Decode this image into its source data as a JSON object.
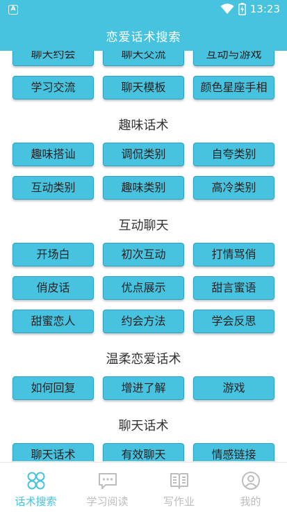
{
  "status_bar": {
    "app_icon_letter": "A",
    "time": "13:23"
  },
  "header": {
    "title": "恋爱话术搜索"
  },
  "sections": [
    {
      "title": "",
      "buttons": [
        "聊天约会",
        "聊天交流",
        "互动与游戏",
        "学习交流",
        "聊天模板",
        "颜色星座手相"
      ]
    },
    {
      "title": "趣味话术",
      "buttons": [
        "趣味搭讪",
        "调侃类别",
        "自夸类别",
        "互动类别",
        "趣味类别",
        "高冷类别"
      ]
    },
    {
      "title": "互动聊天",
      "buttons": [
        "开场白",
        "初次互动",
        "打情骂俏",
        "俏皮话",
        "优点展示",
        "甜言蜜语",
        "甜蜜恋人",
        "约会方法",
        "学会反思"
      ]
    },
    {
      "title": "温柔恋爱话术",
      "buttons": [
        "如何回复",
        "增进了解",
        "游戏"
      ]
    },
    {
      "title": "聊天话术",
      "buttons": [
        "聊天话术",
        "有效聊天",
        "情感链接"
      ]
    }
  ],
  "tabbar": {
    "active_color": "#47c3e0",
    "inactive_color": "#bdbdbd",
    "tabs": [
      {
        "label": "话术搜索",
        "icon": "grid-icon",
        "active": true
      },
      {
        "label": "学习阅读",
        "icon": "chat-icon",
        "active": false
      },
      {
        "label": "写作业",
        "icon": "book-icon",
        "active": false
      },
      {
        "label": "我的",
        "icon": "person-icon",
        "active": false
      }
    ]
  }
}
